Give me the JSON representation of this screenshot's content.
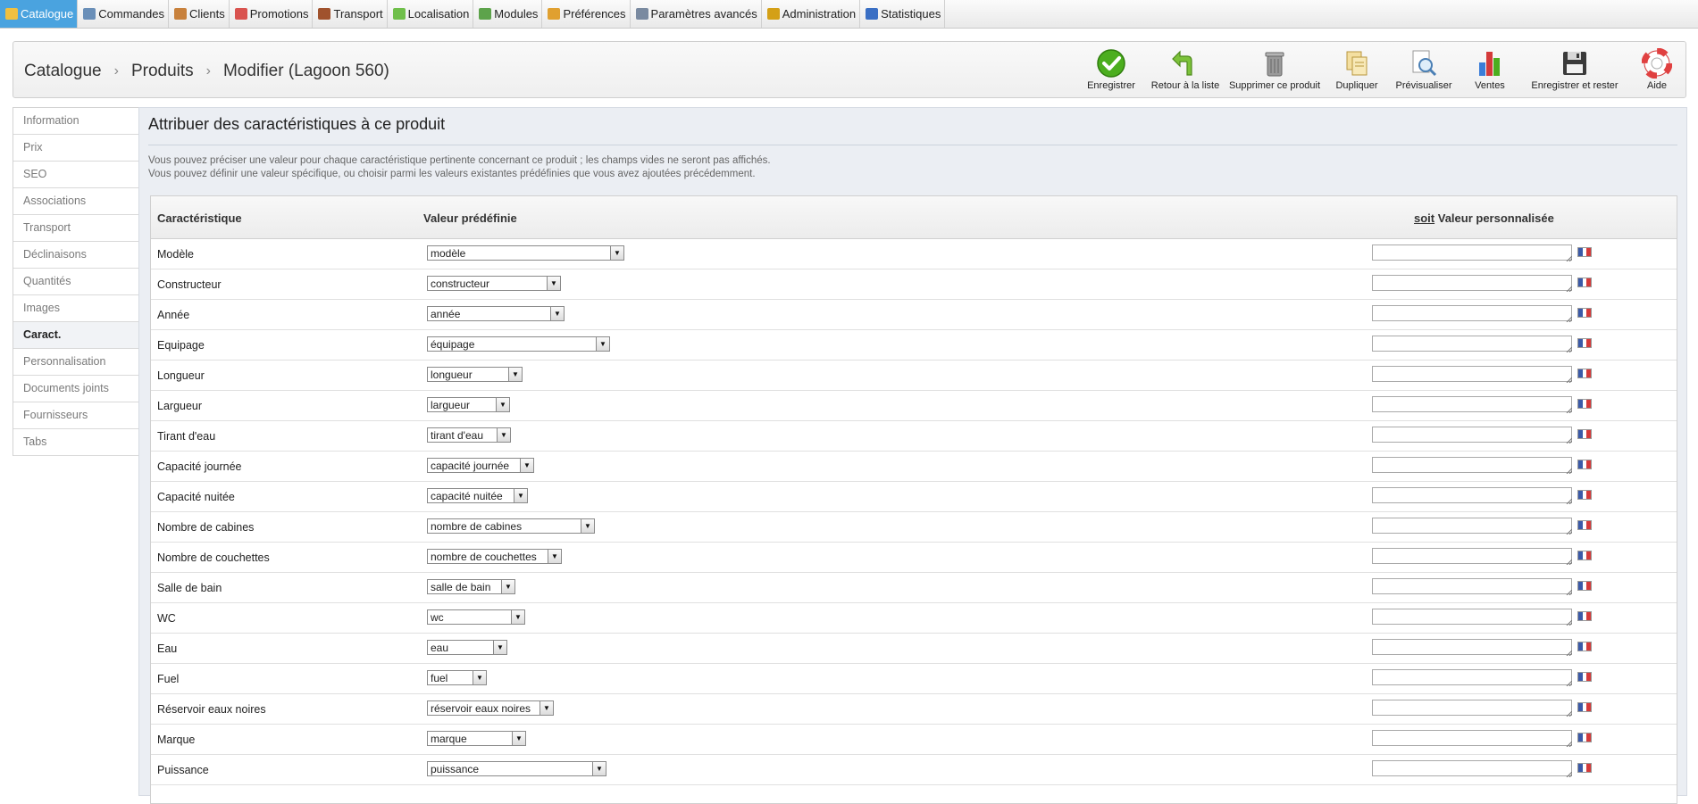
{
  "menu": [
    {
      "label": "Catalogue",
      "icon": "catalogue-icon",
      "active": true,
      "color": "#f0c040"
    },
    {
      "label": "Commandes",
      "icon": "cart-icon",
      "color": "#6a8fb8"
    },
    {
      "label": "Clients",
      "icon": "user-icon",
      "color": "#c8813c"
    },
    {
      "label": "Promotions",
      "icon": "promotion-icon",
      "color": "#d9534f"
    },
    {
      "label": "Transport",
      "icon": "truck-icon",
      "color": "#a0522d"
    },
    {
      "label": "Localisation",
      "icon": "globe-icon",
      "color": "#6fbf4a"
    },
    {
      "label": "Modules",
      "icon": "puzzle-icon",
      "color": "#5da34b"
    },
    {
      "label": "Préférences",
      "icon": "preferences-icon",
      "color": "#e0a030"
    },
    {
      "label": "Paramètres avancés",
      "icon": "wrench-icon",
      "color": "#7a8aa0"
    },
    {
      "label": "Administration",
      "icon": "key-icon",
      "color": "#d4a017"
    },
    {
      "label": "Statistiques",
      "icon": "chart-icon",
      "color": "#3a6fc4"
    }
  ],
  "breadcrumb": [
    "Catalogue",
    "Produits",
    "Modifier (Lagoon 560)"
  ],
  "toolbar": [
    {
      "label": "Enregistrer",
      "icon": "save-check-icon"
    },
    {
      "label": "Retour à la liste",
      "icon": "back-arrow-icon"
    },
    {
      "label": "Supprimer ce produit",
      "icon": "trash-icon"
    },
    {
      "label": "Dupliquer",
      "icon": "duplicate-icon"
    },
    {
      "label": "Prévisualiser",
      "icon": "preview-icon"
    },
    {
      "label": "Ventes",
      "icon": "sales-chart-icon"
    },
    {
      "label": "Enregistrer et rester",
      "icon": "floppy-icon"
    },
    {
      "label": "Aide",
      "icon": "help-lifebuoy-icon"
    }
  ],
  "tabs": [
    {
      "label": "Information"
    },
    {
      "label": "Prix"
    },
    {
      "label": "SEO"
    },
    {
      "label": "Associations"
    },
    {
      "label": "Transport"
    },
    {
      "label": "Déclinaisons"
    },
    {
      "label": "Quantités"
    },
    {
      "label": "Images"
    },
    {
      "label": "Caract.",
      "active": true
    },
    {
      "label": "Personnalisation"
    },
    {
      "label": "Documents joints"
    },
    {
      "label": "Fournisseurs"
    },
    {
      "label": "Tabs"
    }
  ],
  "panel": {
    "title": "Attribuer des caractéristiques à ce produit",
    "intro_line1": "Vous pouvez préciser une valeur pour chaque caractéristique pertinente concernant ce produit ; les champs vides ne seront pas affichés.",
    "intro_line2": "Vous pouvez définir une valeur spécifique, ou choisir parmi les valeurs existantes prédéfinies que vous avez ajoutées précédemment.",
    "col_feature": "Caractéristique",
    "col_predefined": "Valeur prédéfinie",
    "col_custom_prefix": "soit",
    "col_custom": "Valeur personnalisée"
  },
  "features": [
    {
      "name": "Modèle",
      "value": "modèle"
    },
    {
      "name": "Constructeur",
      "value": "constructeur"
    },
    {
      "name": "Année",
      "value": "année"
    },
    {
      "name": "Equipage",
      "value": "équipage"
    },
    {
      "name": "Longueur",
      "value": "longueur"
    },
    {
      "name": "Largueur",
      "value": "largueur"
    },
    {
      "name": "Tirant d'eau",
      "value": "tirant d'eau"
    },
    {
      "name": "Capacité journée",
      "value": "capacité journée"
    },
    {
      "name": "Capacité nuitée",
      "value": "capacité nuitée"
    },
    {
      "name": "Nombre de cabines",
      "value": "nombre de cabines"
    },
    {
      "name": "Nombre de couchettes",
      "value": "nombre de couchettes"
    },
    {
      "name": "Salle de bain",
      "value": "salle de bain"
    },
    {
      "name": "WC",
      "value": "wc"
    },
    {
      "name": "Eau",
      "value": "eau"
    },
    {
      "name": "Fuel",
      "value": "fuel"
    },
    {
      "name": "Réservoir eaux noires",
      "value": "réservoir eaux noires"
    },
    {
      "name": "Marque",
      "value": "marque"
    },
    {
      "name": "Puissance",
      "value": "puissance"
    }
  ],
  "flag_colors": [
    "#3b5aa8",
    "#ffffff",
    "#d43a3a"
  ]
}
